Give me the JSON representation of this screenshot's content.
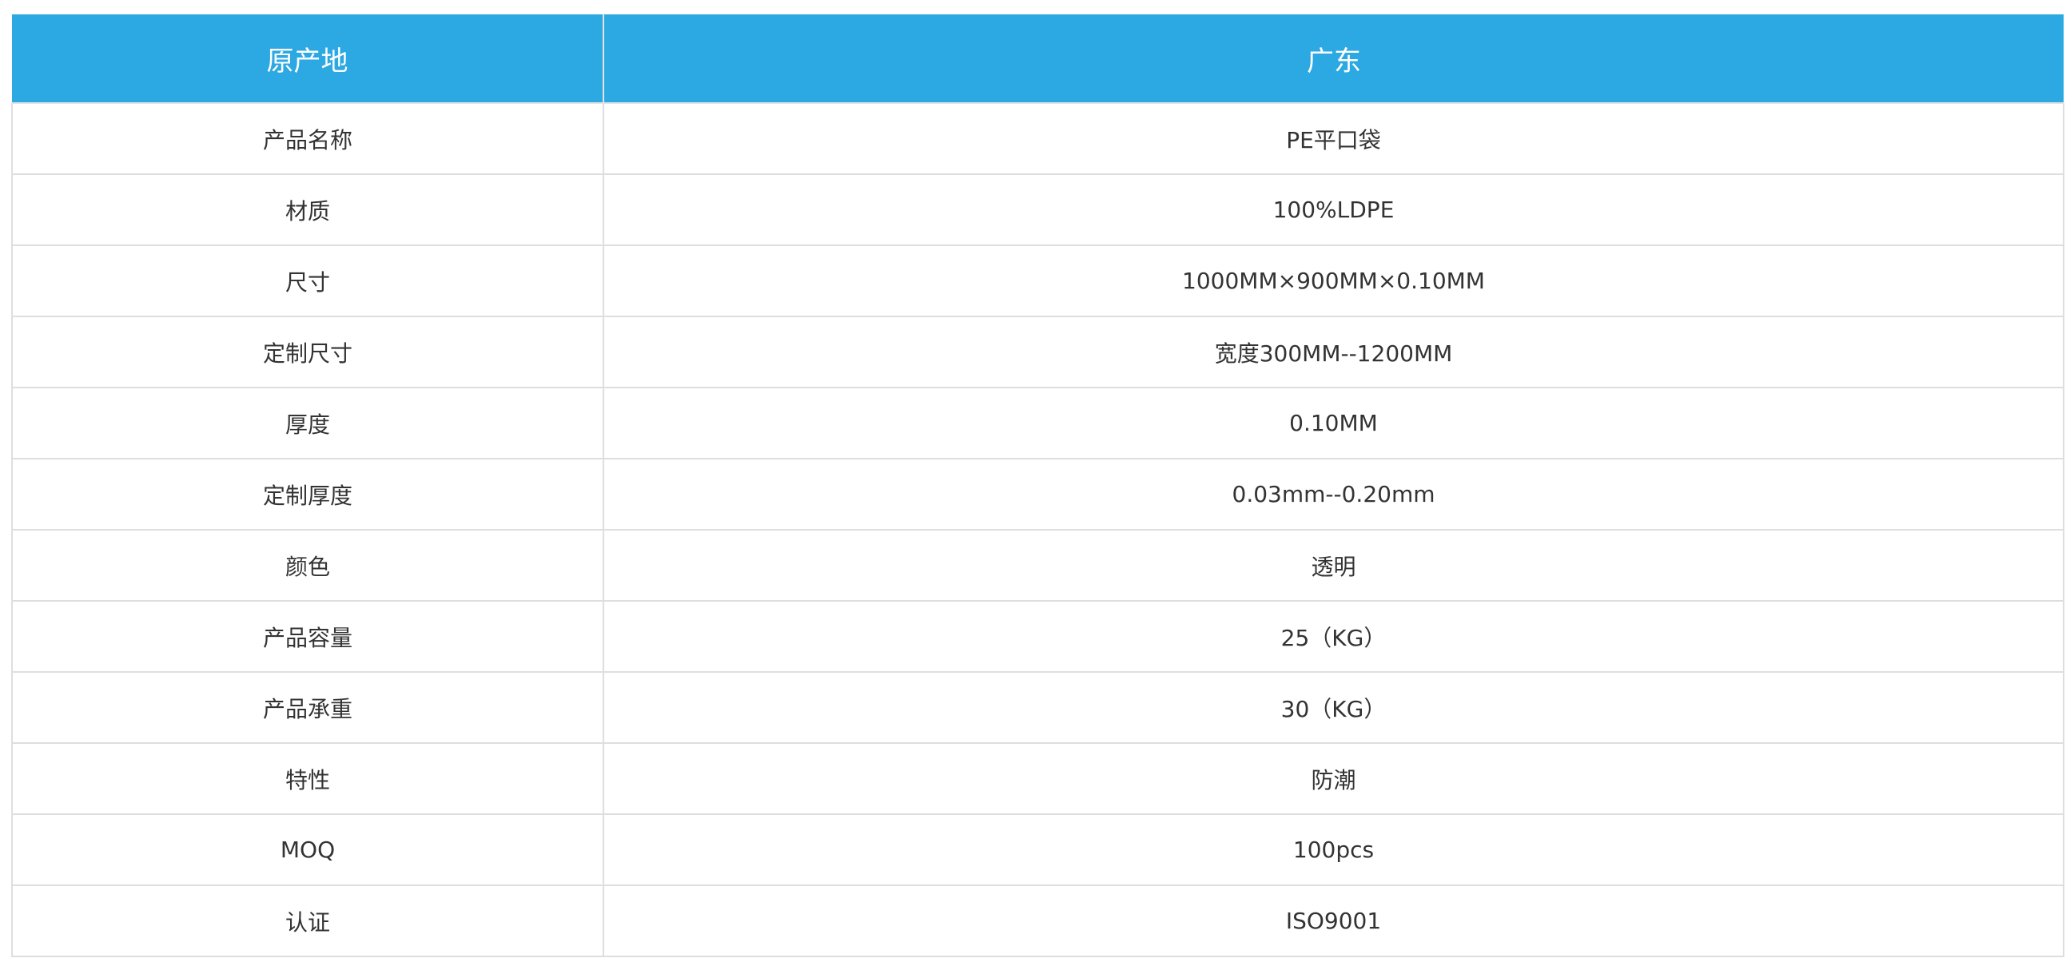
{
  "table": {
    "header": {
      "label": "原产地",
      "value": "广东"
    },
    "rows": [
      {
        "label": "产品名称",
        "value": "PE平口袋"
      },
      {
        "label": "材质",
        "value": "100%LDPE"
      },
      {
        "label": "尺寸",
        "value": "1000MM×900MM×0.10MM"
      },
      {
        "label": "定制尺寸",
        "value": "宽度300MM--1200MM"
      },
      {
        "label": "厚度",
        "value": "0.10MM"
      },
      {
        "label": "定制厚度",
        "value": "0.03mm--0.20mm"
      },
      {
        "label": "颜色",
        "value": "透明"
      },
      {
        "label": "产品容量",
        "value": "25（KG）"
      },
      {
        "label": "产品承重",
        "value": "30（KG）"
      },
      {
        "label": "特性",
        "value": "防潮"
      },
      {
        "label": "MOQ",
        "value": "100pcs"
      },
      {
        "label": "认证",
        "value": "ISO9001"
      }
    ]
  },
  "colors": {
    "header_bg": "#2ca8e2",
    "header_text": "#ffffff",
    "body_text": "#333333",
    "border": "#dedede"
  }
}
